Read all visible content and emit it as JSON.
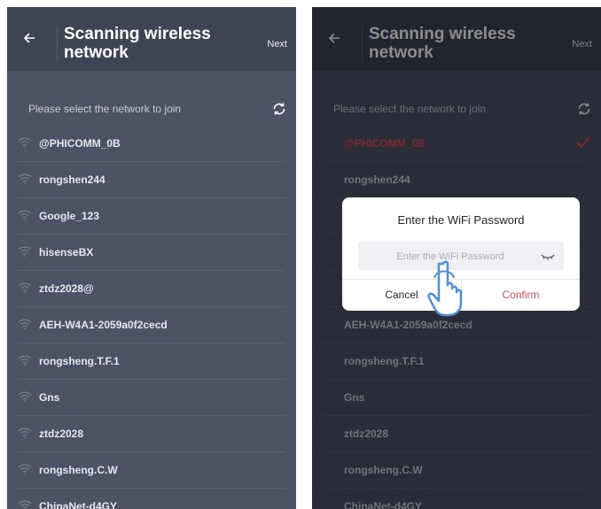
{
  "header": {
    "title": "Scanning wireless network",
    "next_label": "Next"
  },
  "subtitle": "Please select the network to join",
  "networks_left": [
    {
      "name": "@PHICOMM_0B"
    },
    {
      "name": "rongshen244"
    },
    {
      "name": "Google_123"
    },
    {
      "name": "hisenseBX"
    },
    {
      "name": "ztdz2028@"
    },
    {
      "name": "AEH-W4A1-2059a0f2cecd"
    },
    {
      "name": "rongsheng.T.F.1"
    },
    {
      "name": "Gns"
    },
    {
      "name": "ztdz2028"
    },
    {
      "name": "rongsheng.C.W"
    },
    {
      "name": "ChinaNet-d4GY"
    }
  ],
  "networks_right": [
    {
      "name": "@PHICOMM_0B",
      "selected": true
    },
    {
      "name": "rongshen244"
    },
    {
      "name": ""
    },
    {
      "name": ""
    },
    {
      "name": ""
    },
    {
      "name": "AEH-W4A1-2059a0f2cecd"
    },
    {
      "name": "rongsheng.T.F.1"
    },
    {
      "name": "Gns"
    },
    {
      "name": "ztdz2028"
    },
    {
      "name": "rongsheng.C.W"
    },
    {
      "name": "ChinaNet-d4GY"
    }
  ],
  "dialog": {
    "title": "Enter the WiFi Password",
    "placeholder": "Enter the WiFi Password",
    "value": "",
    "cancel_label": "Cancel",
    "confirm_label": "Confirm"
  },
  "colors": {
    "background": "#4d5264",
    "header": "#3f4454",
    "accent_red": "#e04b5a"
  },
  "icons": [
    "back-arrow-icon",
    "refresh-icon",
    "wifi-icon",
    "check-icon",
    "eye-closed-icon",
    "pointing-hand-icon"
  ]
}
